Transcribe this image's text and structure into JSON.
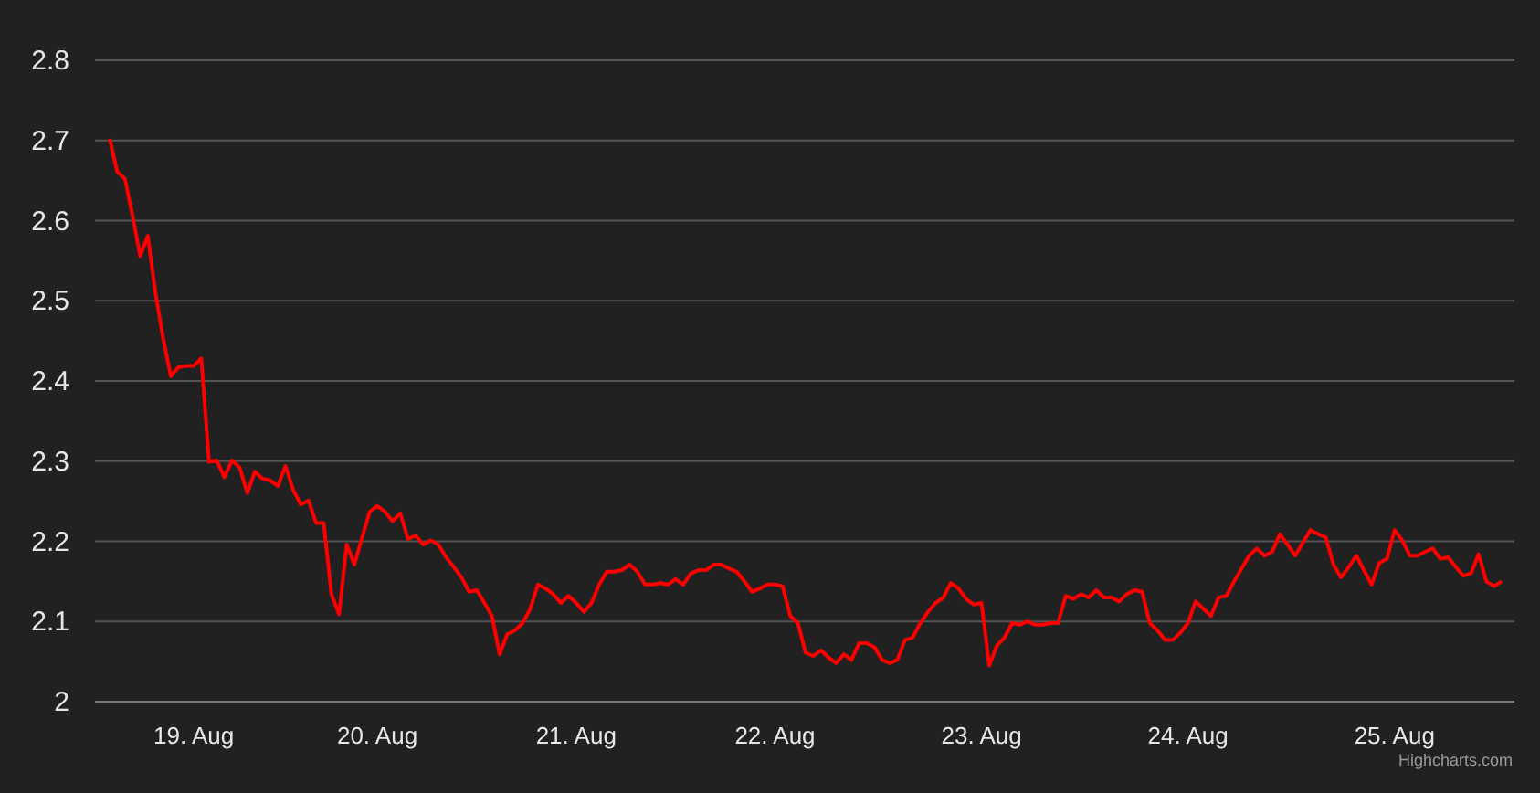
{
  "chart": {
    "chart_data": {
      "type": "line",
      "grid": true,
      "ylim": [
        2,
        2.8
      ],
      "yticks": [
        2,
        2.1,
        2.2,
        2.3,
        2.4,
        2.5,
        2.6,
        2.7,
        2.8
      ],
      "categories": [
        null,
        null,
        null,
        null,
        null,
        null,
        null,
        null,
        null,
        null,
        null,
        "19. Aug",
        null,
        null,
        null,
        null,
        null,
        null,
        null,
        null,
        null,
        null,
        null,
        null,
        null,
        null,
        null,
        null,
        null,
        null,
        null,
        null,
        null,
        null,
        null,
        "20. Aug",
        null,
        null,
        null,
        null,
        null,
        null,
        null,
        null,
        null,
        null,
        null,
        null,
        null,
        null,
        null,
        null,
        null,
        null,
        null,
        null,
        null,
        null,
        null,
        null,
        null,
        "21. Aug",
        null,
        null,
        null,
        null,
        null,
        null,
        null,
        null,
        null,
        null,
        null,
        null,
        null,
        null,
        null,
        null,
        null,
        null,
        null,
        null,
        null,
        null,
        null,
        null,
        null,
        "22. Aug",
        null,
        null,
        null,
        null,
        null,
        null,
        null,
        null,
        null,
        null,
        null,
        null,
        null,
        null,
        null,
        null,
        null,
        null,
        null,
        null,
        null,
        null,
        null,
        null,
        null,
        null,
        "23. Aug",
        null,
        null,
        null,
        null,
        null,
        null,
        null,
        null,
        null,
        null,
        null,
        null,
        null,
        null,
        null,
        null,
        null,
        null,
        null,
        null,
        null,
        null,
        null,
        null,
        null,
        null,
        "24. Aug",
        null,
        null,
        null,
        null,
        null,
        null,
        null,
        null,
        null,
        null,
        null,
        null,
        null,
        null,
        null,
        null,
        null,
        null,
        null,
        null,
        null,
        null,
        null,
        null,
        null,
        null,
        "25. Aug",
        null,
        null,
        null,
        null,
        null,
        null,
        null,
        null,
        null,
        null,
        null,
        null,
        null,
        null
      ],
      "series": [
        {
          "color": "#ff0000",
          "values": [
            2.702,
            2.661,
            2.652,
            2.606,
            2.556,
            2.581,
            2.51,
            2.453,
            2.406,
            2.417,
            2.419,
            2.419,
            2.428,
            2.299,
            2.301,
            2.28,
            2.301,
            2.292,
            2.26,
            2.287,
            2.278,
            2.276,
            2.269,
            2.294,
            2.264,
            2.246,
            2.251,
            2.223,
            2.223,
            2.134,
            2.109,
            2.196,
            2.171,
            2.205,
            2.237,
            2.244,
            2.237,
            2.225,
            2.235,
            2.203,
            2.207,
            2.196,
            2.201,
            2.196,
            2.18,
            2.168,
            2.155,
            2.137,
            2.139,
            2.123,
            2.107,
            2.059,
            2.084,
            2.089,
            2.098,
            2.116,
            2.146,
            2.141,
            2.134,
            2.123,
            2.132,
            2.123,
            2.112,
            2.123,
            2.146,
            2.162,
            2.162,
            2.164,
            2.171,
            2.162,
            2.146,
            2.146,
            2.148,
            2.146,
            2.153,
            2.146,
            2.16,
            2.164,
            2.164,
            2.171,
            2.171,
            2.166,
            2.162,
            2.15,
            2.137,
            2.141,
            2.146,
            2.146,
            2.144,
            2.107,
            2.098,
            2.061,
            2.057,
            2.064,
            2.055,
            2.048,
            2.059,
            2.052,
            2.073,
            2.073,
            2.068,
            2.052,
            2.048,
            2.052,
            2.077,
            2.08,
            2.098,
            2.112,
            2.123,
            2.13,
            2.148,
            2.141,
            2.128,
            2.121,
            2.123,
            2.045,
            2.07,
            2.08,
            2.098,
            2.096,
            2.1,
            2.096,
            2.096,
            2.098,
            2.098,
            2.132,
            2.128,
            2.134,
            2.13,
            2.139,
            2.13,
            2.13,
            2.125,
            2.134,
            2.139,
            2.137,
            2.098,
            2.089,
            2.077,
            2.077,
            2.086,
            2.098,
            2.125,
            2.116,
            2.107,
            2.13,
            2.132,
            2.15,
            2.166,
            2.182,
            2.191,
            2.182,
            2.187,
            2.209,
            2.196,
            2.182,
            2.198,
            2.214,
            2.209,
            2.205,
            2.171,
            2.155,
            2.168,
            2.182,
            2.164,
            2.146,
            2.173,
            2.178,
            2.214,
            2.201,
            2.182,
            2.182,
            2.187,
            2.191,
            2.178,
            2.18,
            2.168,
            2.157,
            2.16,
            2.184,
            2.15,
            2.144,
            2.15
          ]
        }
      ]
    }
  },
  "credits": "Highcharts.com"
}
